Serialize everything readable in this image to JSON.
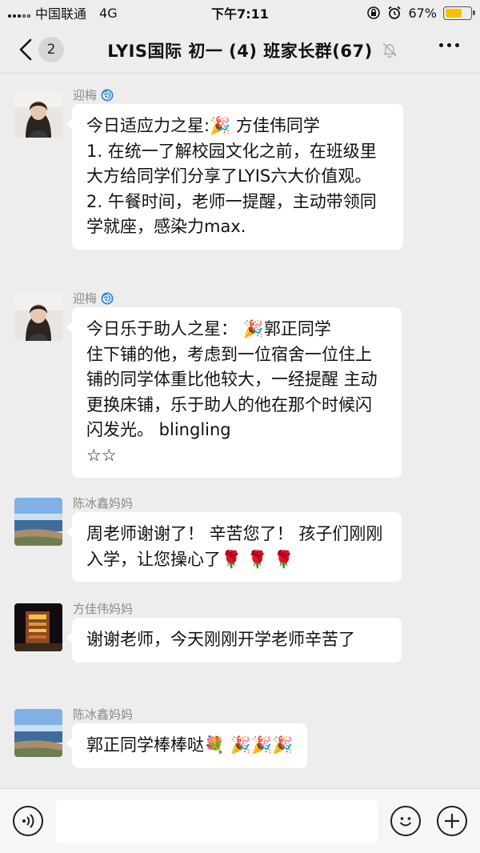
{
  "status_bar": {
    "carrier": "中国联通",
    "network": "4G",
    "time": "下午7:11",
    "battery_percent": "67%",
    "battery_level": 0.67
  },
  "nav": {
    "back_count": "2",
    "title": "LYIS国际 初一 (4) 班家长群(67)"
  },
  "messages": [
    {
      "sender": "迎梅",
      "text": "今日适应力之星:🎉 方佳伟同学\n1. 在统一了解校园文化之前，在班级里大方给同学们分享了LYIS六大价值观。\n2. 午餐时间，老师一提醒，主动带领同学就座，感染力max."
    },
    {
      "sender": "迎梅",
      "text": "今日乐于助人之星： 🎉郭正同学\n住下铺的他，考虑到一位宿舍一位住上铺的同学体重比他较大，一经提醒 主动更换床铺，乐于助人的他在那个时候闪闪发光。 blingling\n☆☆"
    },
    {
      "sender": "陈冰鑫妈妈",
      "text": "周老师谢谢了！ 辛苦您了！ 孩子们刚刚入学，让您操心了🌹 🌹 🌹"
    },
    {
      "sender": "方佳伟妈妈",
      "text": "谢谢老师，今天刚刚开学老师辛苦了"
    },
    {
      "sender": "陈冰鑫妈妈",
      "text": "郭正同学棒棒哒💐 🎉🎉🎉"
    }
  ],
  "icons": {
    "back": "chevron-left-icon",
    "mute": "bell-off-icon",
    "more": "more-dots-icon",
    "voice": "voice-icon",
    "emoji": "emoji-icon",
    "plus": "plus-icon",
    "wechat_badge": "spiral-icon"
  },
  "colors": {
    "background": "#ededed",
    "bubble": "#ffffff",
    "battery": "#f5c400"
  }
}
